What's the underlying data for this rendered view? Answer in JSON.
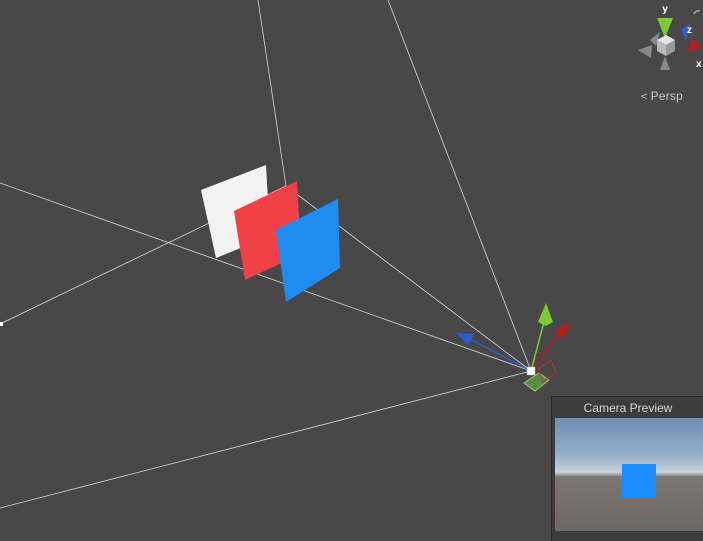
{
  "scene": {
    "background_color": "#484848",
    "quads": [
      {
        "name": "white-quad",
        "color": "#f2f2f2"
      },
      {
        "name": "red-quad",
        "color": "#f04048"
      },
      {
        "name": "blue-quad",
        "color": "#1e8cf0"
      }
    ]
  },
  "orientation_gizmo": {
    "axes": [
      "y",
      "z",
      "x"
    ],
    "colors": {
      "x": "#b31d1d",
      "y": "#7acb34",
      "z": "#2b5bd6"
    },
    "projection_label": "Persp"
  },
  "camera_preview": {
    "title": "Camera Preview",
    "cube_color": "#1a8cff"
  }
}
